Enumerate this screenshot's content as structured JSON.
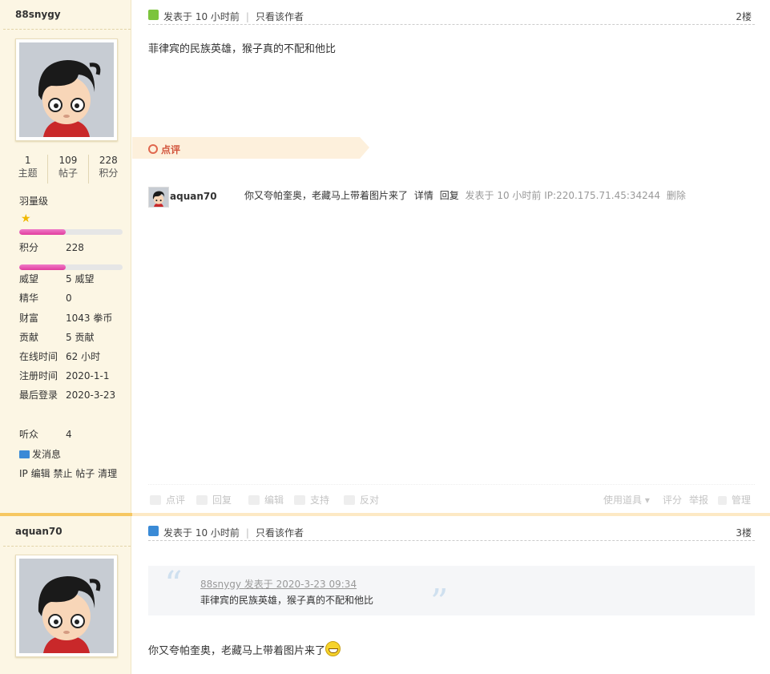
{
  "post1": {
    "author": "88snygy",
    "stats": [
      {
        "num": "1",
        "label": "主题"
      },
      {
        "num": "109",
        "label": "帖子"
      },
      {
        "num": "228",
        "label": "积分"
      }
    ],
    "level": "羽量级",
    "score_label": "积分",
    "score_value": "228",
    "rows": [
      {
        "k": "威望",
        "v": "5 威望"
      },
      {
        "k": "精华",
        "v": "0"
      },
      {
        "k": "财富",
        "v": "1043 拳币"
      },
      {
        "k": "贡献",
        "v": "5 贡献"
      },
      {
        "k": "在线时间",
        "v": "62 小时"
      },
      {
        "k": "注册时间",
        "v": "2020-1-1"
      },
      {
        "k": "最后登录",
        "v": "2020-3-23"
      }
    ],
    "listeners_label": "听众",
    "listeners_value": "4",
    "send_msg": "发消息",
    "admin_links": [
      "IP",
      "编辑",
      "禁止",
      "帖子",
      "清理"
    ],
    "posted": "发表于 10 小时前",
    "only_author": "只看该作者",
    "floor": "2楼",
    "content": "菲律宾的民族英雄，猴子真的不配和他比",
    "rate_tab": "点评",
    "comment": {
      "user": "aquan70",
      "text": "你又夸帕奎奥，老藏马上带着图片来了",
      "detail": "详情",
      "reply": "回复",
      "meta": "发表于 10 小时前 IP:220.175.71.45:34244",
      "delete": "删除"
    },
    "actions": {
      "rate": "点评",
      "reply": "回复",
      "edit": "编辑",
      "support": "支持",
      "oppose": "反对",
      "tools": "使用道具",
      "score": "评分",
      "report": "举报",
      "manage": "管理"
    }
  },
  "post2": {
    "author": "aquan70",
    "posted": "发表于 10 小时前",
    "only_author": "只看该作者",
    "floor": "3楼",
    "quote_source": "88snygy 发表于 2020-3-23 09:34",
    "quote_text": "菲律宾的民族英雄，猴子真的不配和他比",
    "content": "你又夸帕奎奥，老藏马上带着图片来了"
  },
  "colors": {
    "sidebar_bg": "#fcf6e4",
    "divider": "#f6c761",
    "rate_tab": "#fdf0dc",
    "accent_red": "#d2543c"
  }
}
